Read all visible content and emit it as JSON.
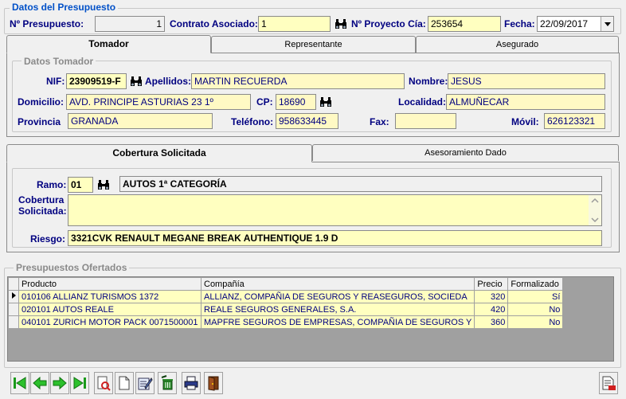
{
  "datos_presupuesto": {
    "title": "Datos del Presupuesto",
    "num_presupuesto_label": "Nº Presupuesto:",
    "num_presupuesto": "1",
    "contrato_label": "Contrato Asociado:",
    "contrato": "1",
    "proyecto_label": "Nº Proyecto Cía:",
    "proyecto": "253654",
    "fecha_label": "Fecha:",
    "fecha": "22/09/2017"
  },
  "tabs_top": [
    {
      "label": "Tomador"
    },
    {
      "label": "Representante"
    },
    {
      "label": "Asegurado"
    }
  ],
  "tomador": {
    "title": "Datos Tomador",
    "nif_label": "NIF:",
    "nif": "23909519-F",
    "apellidos_label": "Apellidos:",
    "apellidos": "MARTIN RECUERDA",
    "nombre_label": "Nombre:",
    "nombre": "JESUS",
    "domicilio_label": "Domicilio:",
    "domicilio": "AVD. PRINCIPE ASTURIAS 23 1º",
    "cp_label": "CP:",
    "cp": "18690",
    "localidad_label": "Localidad:",
    "localidad": "ALMUÑECAR",
    "provincia_label": "Provincia",
    "provincia": "GRANADA",
    "telefono_label": "Teléfono:",
    "telefono": "958633445",
    "fax_label": "Fax:",
    "fax": "",
    "movil_label": "Móvil:",
    "movil": "626123321"
  },
  "tabs_mid": [
    {
      "label": "Cobertura Solicitada"
    },
    {
      "label": "Asesoramiento Dado"
    }
  ],
  "cobertura": {
    "ramo_label": "Ramo:",
    "ramo_code": "01",
    "ramo_desc": "AUTOS 1ª CATEGORÍA",
    "cobertura_label_1": "Cobertura",
    "cobertura_label_2": "Solicitada:",
    "cobertura_text": "",
    "riesgo_label": "Riesgo:",
    "riesgo": "3321CVK RENAULT MEGANE BREAK AUTHENTIQUE 1.9 D"
  },
  "ofertados": {
    "title": "Presupuestos Ofertados",
    "columns": [
      "Producto",
      "Compañía",
      "Precio",
      "Formalizado"
    ],
    "rows": [
      {
        "producto": "010106 ALLIANZ TURISMOS 1372",
        "compania": "ALLIANZ, COMPAÑIA DE SEGUROS Y REASEGUROS, SOCIEDA",
        "precio": "320",
        "formalizado": "Sí"
      },
      {
        "producto": "020101 AUTOS REALE",
        "compania": "REALE SEGUROS GENERALES, S.A.",
        "precio": "420",
        "formalizado": "No"
      },
      {
        "producto": "040101 ZURICH MOTOR PACK 0071500001",
        "compania": "MAPFRE SEGUROS DE EMPRESAS, COMPAÑIA DE SEGUROS Y",
        "precio": "360",
        "formalizado": "No"
      }
    ]
  },
  "toolbar": {
    "icons": [
      "first-icon",
      "prev-icon",
      "next-icon",
      "last-icon",
      "search-icon",
      "new-icon",
      "edit-icon",
      "delete-icon",
      "print-icon",
      "exit-icon",
      "report-icon"
    ]
  }
}
